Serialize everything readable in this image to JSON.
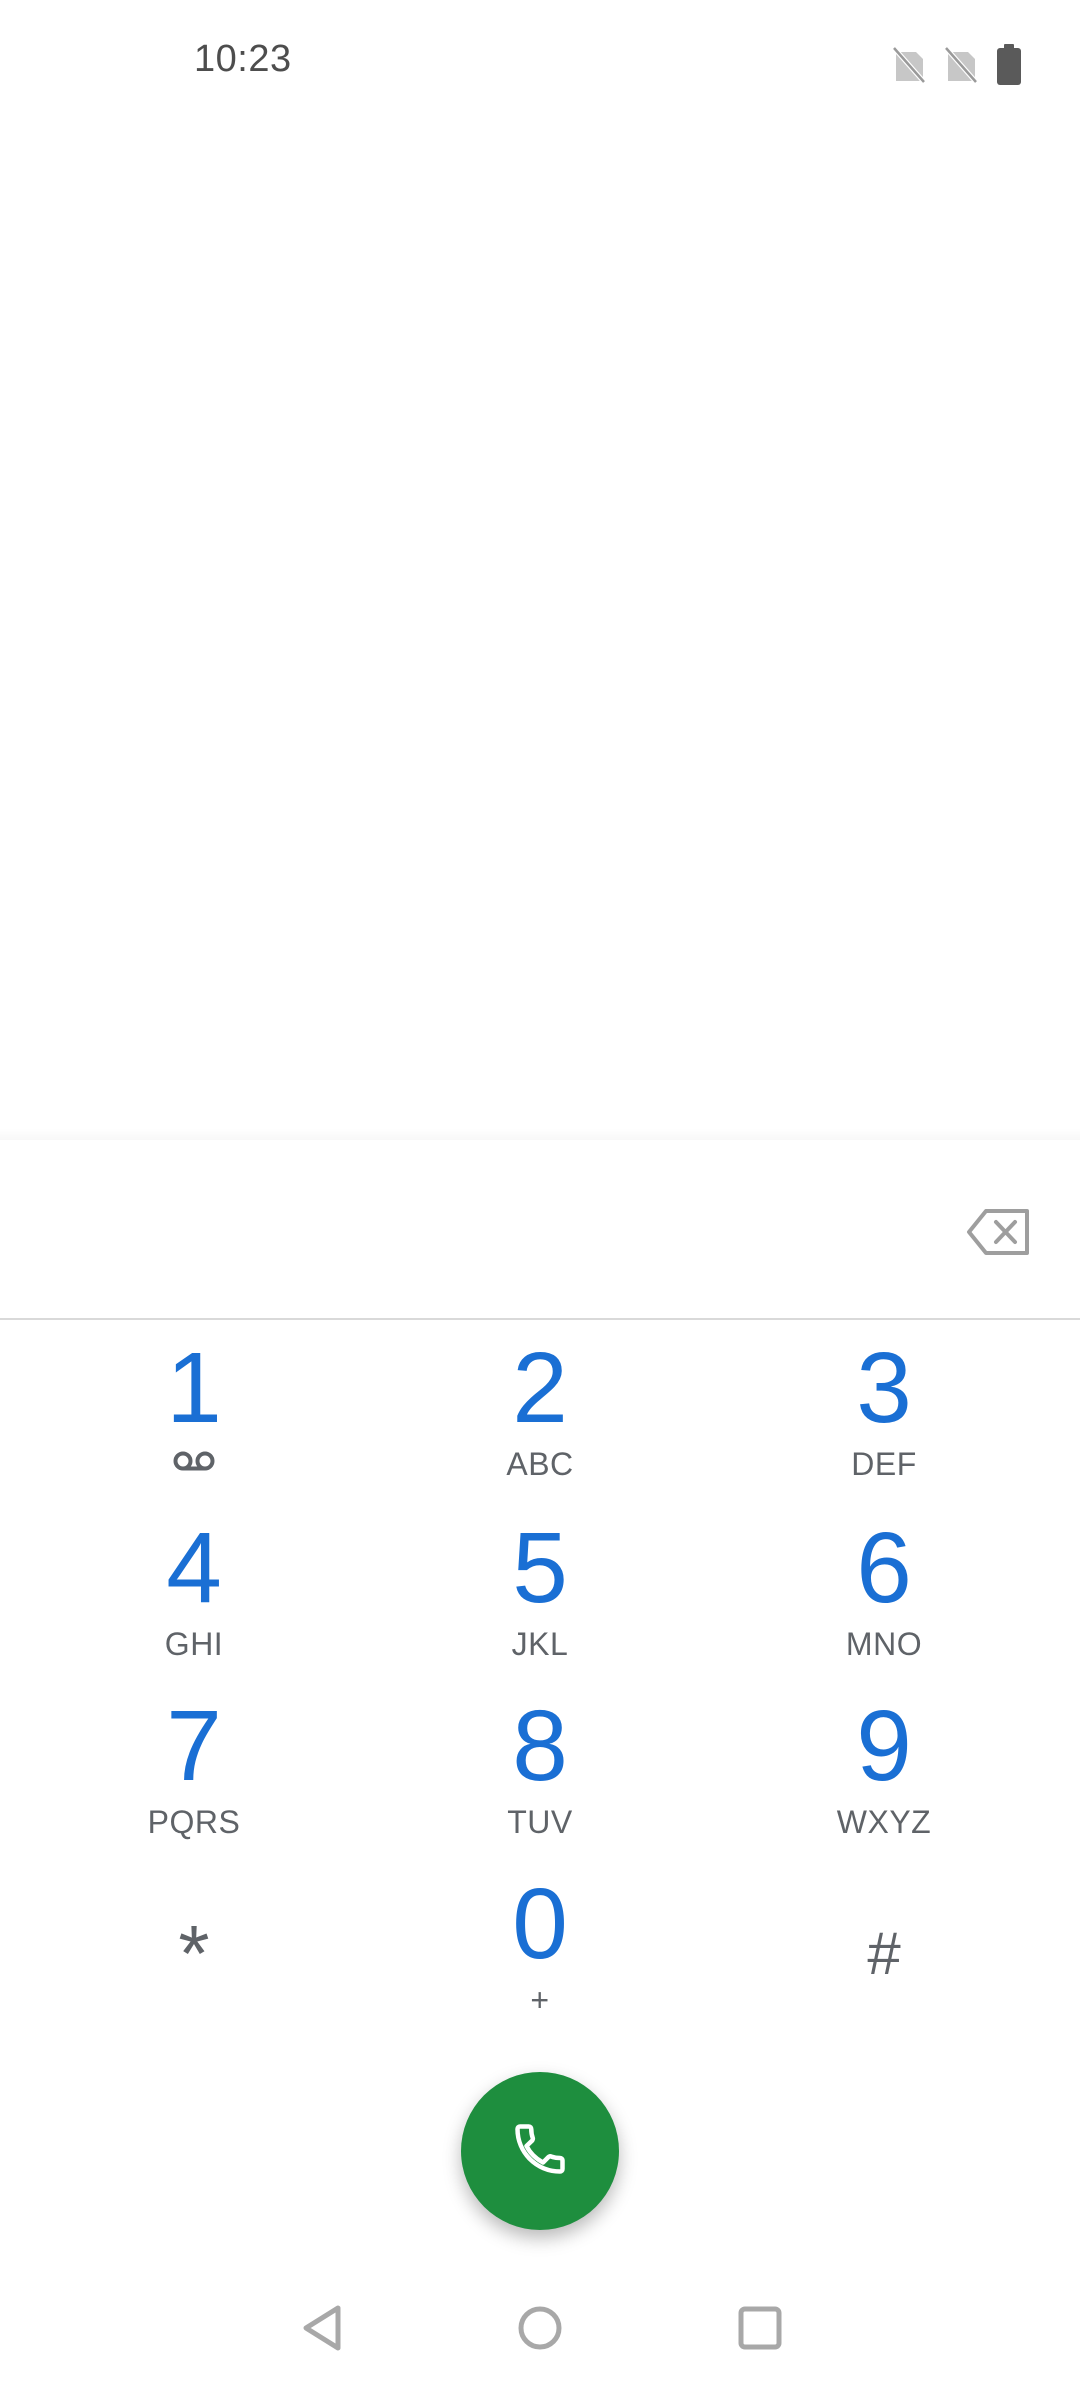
{
  "status_bar": {
    "time": "10:23",
    "icons": [
      "no-sim-icon",
      "no-sim-icon",
      "battery-icon"
    ]
  },
  "dialer": {
    "entered_digits": "",
    "backspace_icon": "backspace-icon",
    "keys": [
      {
        "digit": "1",
        "letters": "",
        "sub_icon": "voicemail-icon"
      },
      {
        "digit": "2",
        "letters": "ABC"
      },
      {
        "digit": "3",
        "letters": "DEF"
      },
      {
        "digit": "4",
        "letters": "GHI"
      },
      {
        "digit": "5",
        "letters": "JKL"
      },
      {
        "digit": "6",
        "letters": "MNO"
      },
      {
        "digit": "7",
        "letters": "PQRS"
      },
      {
        "digit": "8",
        "letters": "TUV"
      },
      {
        "digit": "9",
        "letters": "WXYZ"
      },
      {
        "digit": "*",
        "letters": ""
      },
      {
        "digit": "0",
        "letters": "+"
      },
      {
        "digit": "#",
        "letters": ""
      }
    ],
    "call_button_icon": "phone-icon"
  },
  "nav_bar": {
    "icons": [
      "back-icon",
      "home-icon",
      "recents-icon"
    ]
  },
  "colors": {
    "digit_blue": "#1a6fd4",
    "call_green": "#1e8e3e",
    "secondary_gray": "#5f6368"
  }
}
